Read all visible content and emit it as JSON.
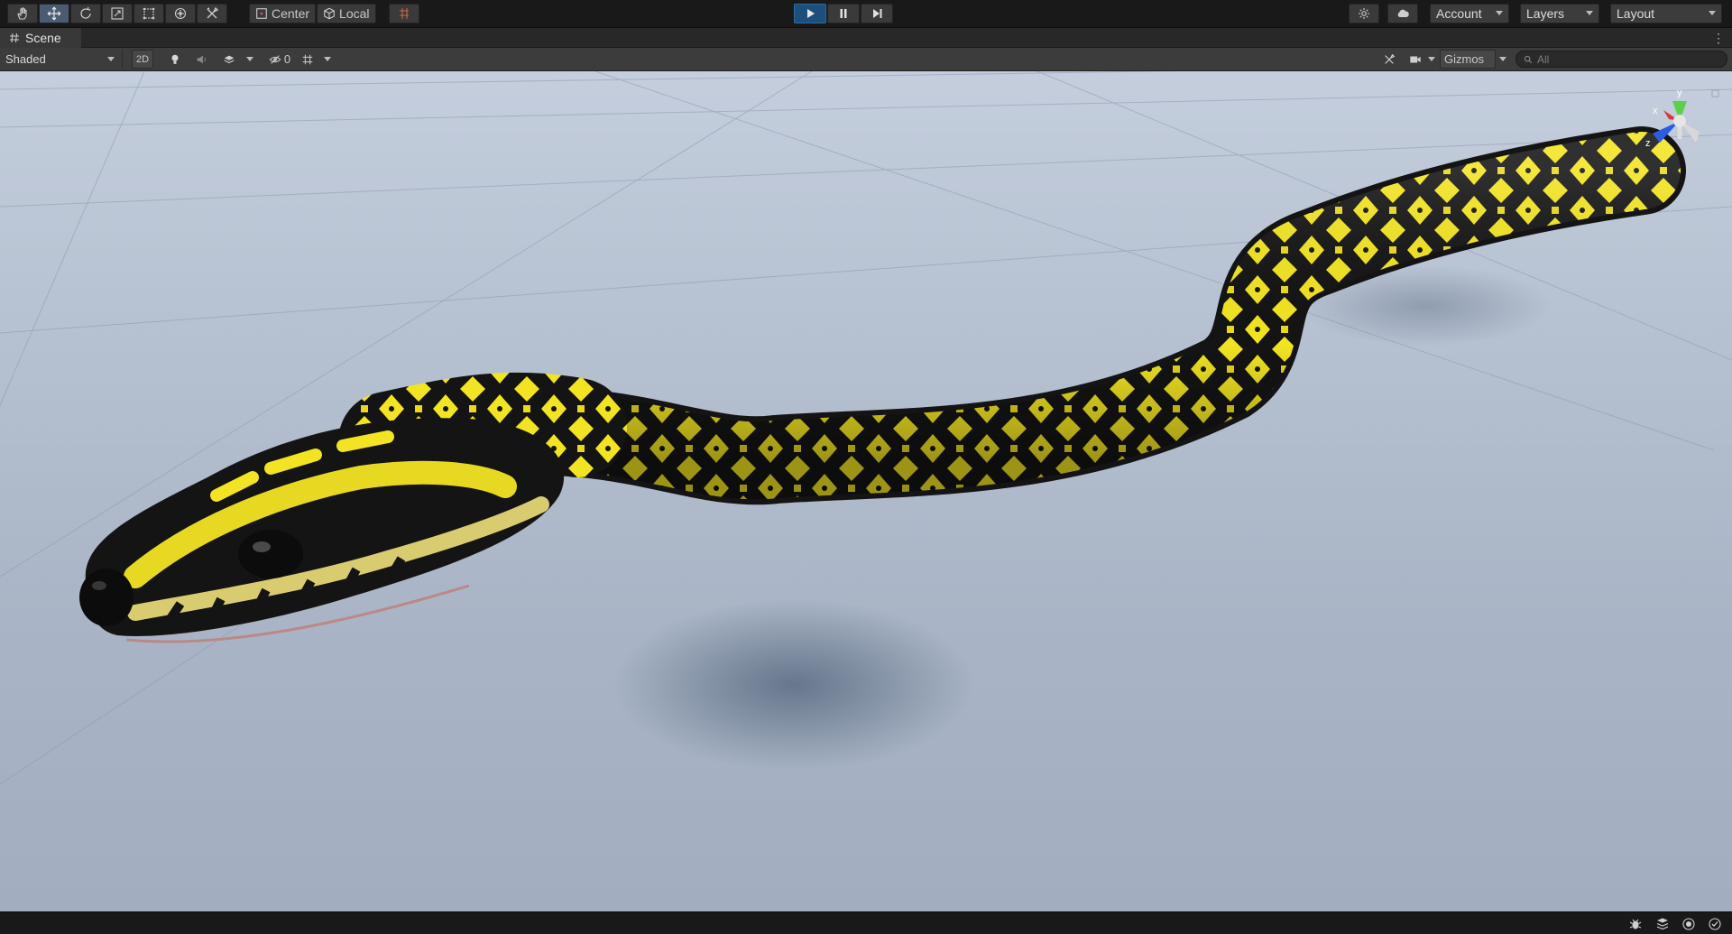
{
  "toolbar": {
    "tools": [
      {
        "name": "hand-tool",
        "icon": "hand-icon",
        "active": false
      },
      {
        "name": "move-tool",
        "icon": "move-arrows-icon",
        "active": true
      },
      {
        "name": "rotate-tool",
        "icon": "rotate-icon",
        "active": false
      },
      {
        "name": "scale-tool",
        "icon": "scale-icon",
        "active": false
      },
      {
        "name": "rect-tool",
        "icon": "rect-transform-icon",
        "active": false
      },
      {
        "name": "transform-tool",
        "icon": "transform-icon",
        "active": false
      },
      {
        "name": "custom-tool",
        "icon": "custom-tools-icon",
        "active": false
      }
    ],
    "pivot_label": "Center",
    "space_label": "Local",
    "snap_icon": "grid-snap-icon",
    "play_state": {
      "playing": true,
      "paused": false
    },
    "account_label": "Account",
    "layers_label": "Layers",
    "layout_label": "Layout"
  },
  "scene_tab": {
    "icon": "scene-hash-icon",
    "label": "Scene"
  },
  "scene_toolbar": {
    "draw_mode": "Shaded",
    "toggle_2d": "2D",
    "hidden_count": "0",
    "gizmos_label": "Gizmos",
    "search_placeholder": "All"
  },
  "scene_gizmo": {
    "axis_y": "y",
    "axis_x": "x",
    "axis_z": "z"
  },
  "colors": {
    "accent_play": "#1e4f7c",
    "snake_yellow": "#f2e422",
    "snake_black": "#141414",
    "ground": "#b6c1d1"
  }
}
